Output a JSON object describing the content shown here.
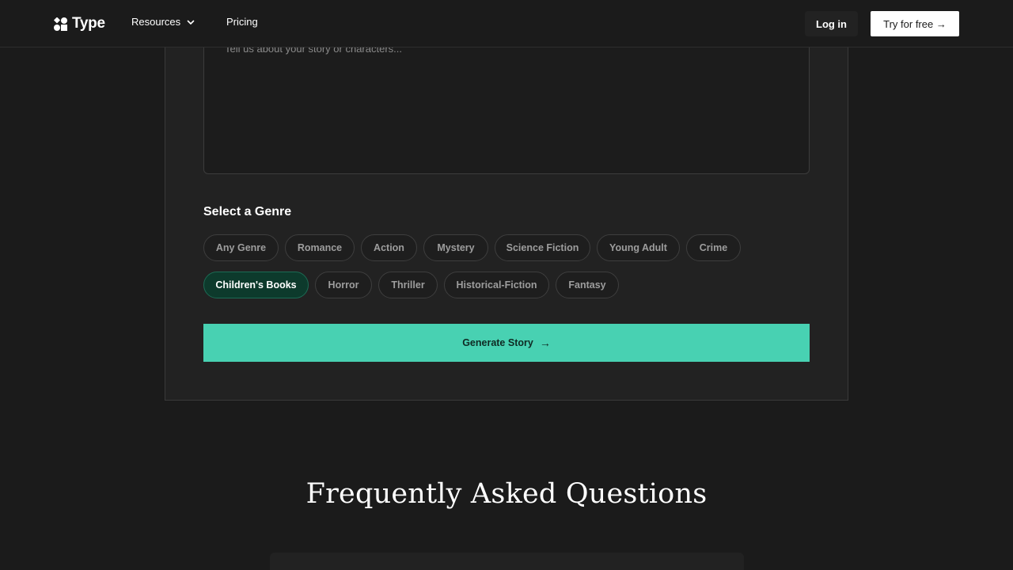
{
  "nav": {
    "brand": "Type",
    "resources": "Resources",
    "pricing": "Pricing",
    "login": "Log in",
    "try_free": "Try for free →"
  },
  "form": {
    "textarea_placeholder": "Tell us about your story or characters...",
    "genre_heading": "Select a Genre",
    "genres": [
      "Any Genre",
      "Romance",
      "Action",
      "Mystery",
      "Science Fiction",
      "Young Adult",
      "Crime",
      "Children's Books",
      "Horror",
      "Thriller",
      "Historical-Fiction",
      "Fantasy"
    ],
    "selected_genre": "Children's Books",
    "generate_label": "Generate Story",
    "generate_arrow": "→"
  },
  "faq": {
    "title": "Frequently Asked Questions"
  },
  "colors": {
    "accent": "#48d1b2",
    "selected_chip": "#0d3a2c",
    "background": "#1b1b1b"
  }
}
